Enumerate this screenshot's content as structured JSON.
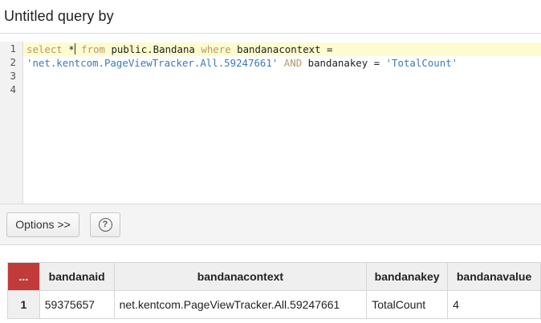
{
  "title": "Untitled query by",
  "editor": {
    "line_numbers": [
      "1",
      "2",
      "3",
      "4"
    ],
    "line1": {
      "t1": "select",
      "t2": " *",
      "t3": " from",
      "t4": " public.Bandana ",
      "t5": "where",
      "t6": " bandanacontext ="
    },
    "line2": {
      "t1": "'net.kentcom.PageViewTracker.All.59247661'",
      "t2": " AND",
      "t3": " bandanakey = ",
      "t4": "'TotalCount'"
    }
  },
  "toolbar": {
    "options_label": "Options >>",
    "help_label": "?"
  },
  "results": {
    "corner_label": "...",
    "columns": [
      "bandanaid",
      "bandanacontext",
      "bandanakey",
      "bandanavalue"
    ],
    "rows": [
      {
        "num": "1",
        "cells": [
          "59375657",
          "net.kentcom.PageViewTracker.All.59247661",
          "TotalCount",
          "4"
        ]
      }
    ]
  },
  "colors": {
    "keyword": "#b89a6a",
    "string": "#3a7ab8",
    "corner": "#c13b3b",
    "active_line": "#fdfbd0"
  }
}
